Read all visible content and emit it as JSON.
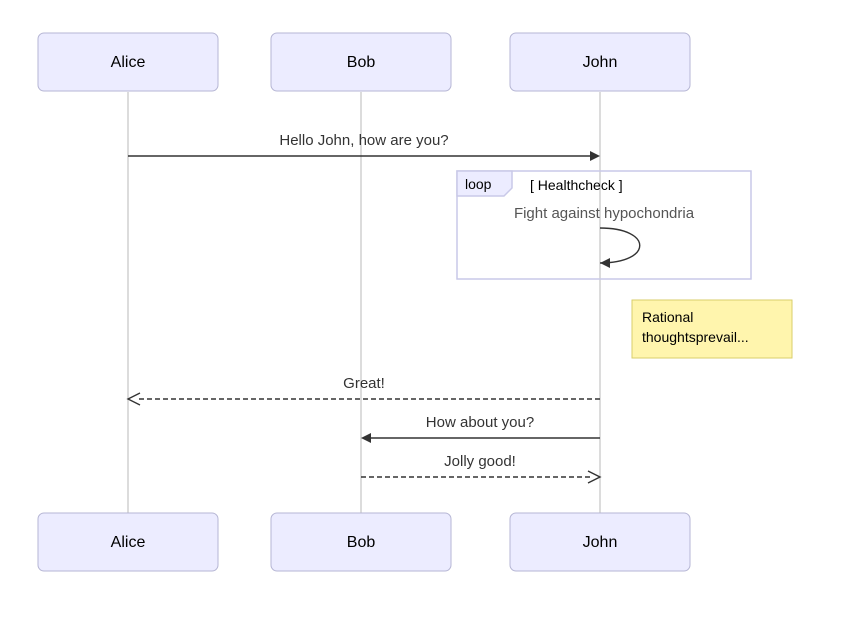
{
  "actors": {
    "alice": "Alice",
    "bob": "Bob",
    "john": "John"
  },
  "messages": {
    "m1": "Hello John, how are you?",
    "m2": "Fight against hypochondria",
    "m3": "Great!",
    "m4": "How about you?",
    "m5": "Jolly good!"
  },
  "loop": {
    "tag": "loop",
    "title": "[ Healthcheck ]"
  },
  "note": {
    "line1": "Rational",
    "line2": "thoughtsprevail..."
  },
  "chart_data": {
    "type": "sequence-diagram",
    "actors": [
      "Alice",
      "Bob",
      "John"
    ],
    "interactions": [
      {
        "from": "Alice",
        "to": "John",
        "label": "Hello John, how are you?",
        "style": "solid-closed-arrow"
      },
      {
        "block": "loop",
        "title": "Healthcheck",
        "contents": [
          {
            "from": "John",
            "to": "John",
            "label": "Fight against hypochondria",
            "style": "self"
          }
        ]
      },
      {
        "note": {
          "position": "right of John",
          "text": "Rational thoughtsprevail..."
        }
      },
      {
        "from": "John",
        "to": "Alice",
        "label": "Great!",
        "style": "dashed-open-arrow"
      },
      {
        "from": "John",
        "to": "Bob",
        "label": "How about you?",
        "style": "solid-closed-arrow"
      },
      {
        "from": "Bob",
        "to": "John",
        "label": "Jolly good!",
        "style": "dashed-open-arrow"
      }
    ]
  }
}
